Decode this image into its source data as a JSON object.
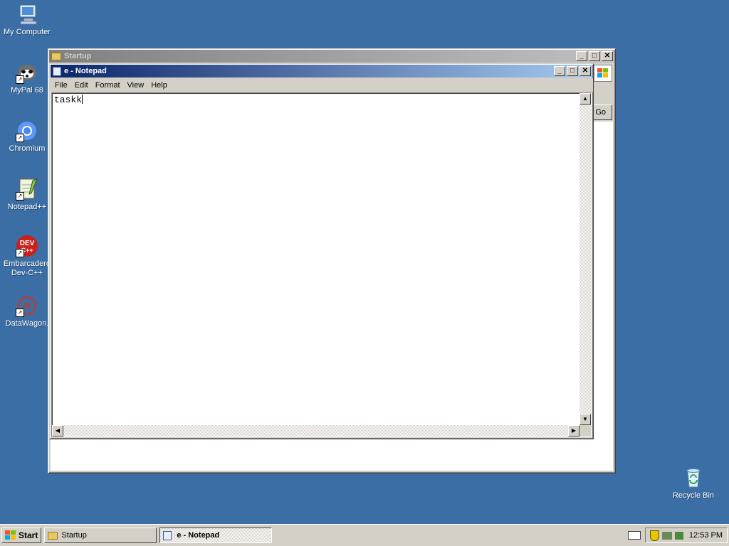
{
  "desktop": {
    "icons": [
      {
        "label": "My Computer",
        "icon": "my-computer-icon"
      },
      {
        "label": "MyPal 68",
        "icon": "mypal-icon"
      },
      {
        "label": "Chromium",
        "icon": "chromium-icon"
      },
      {
        "label": "Notepad++",
        "icon": "notepadpp-icon"
      },
      {
        "label": "Embarcadero Dev-C++",
        "icon": "devcpp-icon"
      },
      {
        "label": "DataWagon.",
        "icon": "datawagon-icon"
      },
      {
        "label": "Recycle Bin",
        "icon": "recycle-bin-icon"
      }
    ],
    "background_color": "#3a6ea5"
  },
  "startup_window": {
    "title": "Startup",
    "go_label": "Go"
  },
  "notepad": {
    "title": "e - Notepad",
    "menu": [
      "File",
      "Edit",
      "Format",
      "View",
      "Help"
    ],
    "content": "taskk"
  },
  "taskbar": {
    "start_label": "Start",
    "tasks": [
      {
        "label": "Startup",
        "active": false
      },
      {
        "label": "e - Notepad",
        "active": true
      }
    ],
    "clock": "12:53 PM"
  }
}
